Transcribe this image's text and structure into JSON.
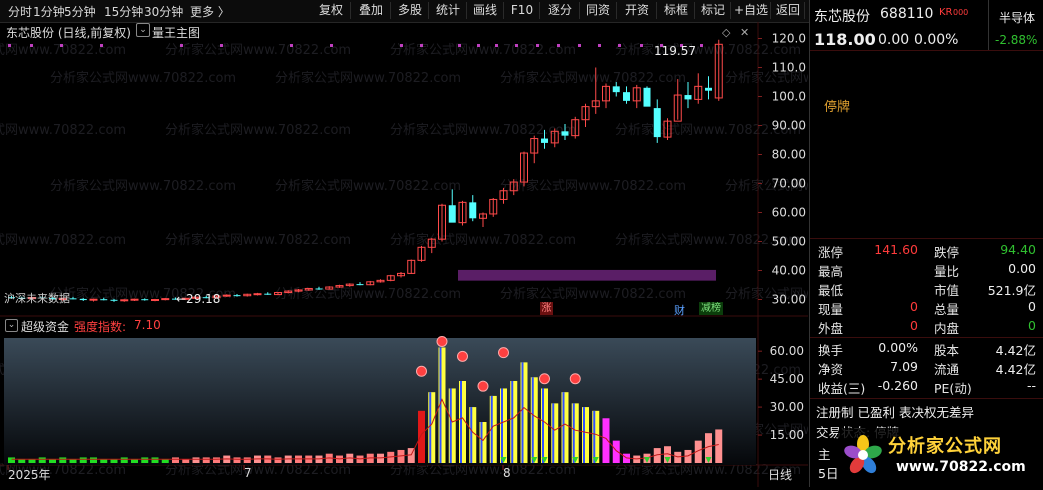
{
  "toolbar": {
    "periods": [
      "分时",
      "1分钟",
      "5分钟",
      "15分钟",
      "30分钟",
      "更多 〉"
    ],
    "buttons": [
      "复权",
      "叠加",
      "多股",
      "统计",
      "画线",
      "F10",
      "逐分",
      "同资",
      "开资",
      "标框",
      "标记",
      "+自选",
      "返回"
    ]
  },
  "main_chart": {
    "title": "东芯股份 (日线,前复权)",
    "indicator": "量王主图",
    "high_label": "119.57",
    "low_label": "←29.18",
    "stock_tag": "沪深未来数据",
    "y_ticks": [
      "120.0",
      "110.0",
      "100.0",
      "90.00",
      "80.00",
      "70.00",
      "60.00",
      "50.00",
      "40.00",
      "30.00"
    ],
    "markers": [
      "涨",
      "财",
      "减榜"
    ]
  },
  "sub_chart": {
    "title": "超级资金",
    "strength_label": "强度指数:",
    "strength_value": "7.10",
    "y_ticks": [
      "60.00",
      "45.00",
      "30.00",
      "15.00"
    ]
  },
  "x_axis": {
    "labels": [
      "2025年",
      "7",
      "8"
    ],
    "period": "日线"
  },
  "chart_data": {
    "type": "candlestick",
    "series_name": "东芯股份 日线 前复权",
    "ylim": [
      25,
      125
    ],
    "ohlc": [
      [
        30.8,
        31.2,
        30.2,
        30.6
      ],
      [
        30.6,
        31.0,
        30.0,
        30.3
      ],
      [
        30.3,
        30.9,
        29.9,
        30.7
      ],
      [
        30.7,
        31.1,
        30.3,
        30.5
      ],
      [
        30.5,
        30.8,
        29.8,
        30.0
      ],
      [
        30.0,
        30.6,
        29.6,
        30.4
      ],
      [
        30.4,
        30.9,
        30.1,
        30.2
      ],
      [
        30.2,
        30.5,
        29.5,
        29.8
      ],
      [
        29.8,
        30.3,
        29.3,
        30.1
      ],
      [
        30.1,
        30.6,
        29.7,
        29.9
      ],
      [
        29.9,
        30.2,
        29.18,
        29.6
      ],
      [
        29.6,
        30.1,
        29.2,
        29.9
      ],
      [
        29.9,
        30.3,
        29.5,
        30.1
      ],
      [
        30.1,
        30.4,
        29.6,
        29.8
      ],
      [
        29.8,
        30.2,
        29.4,
        30.0
      ],
      [
        30.0,
        30.5,
        29.7,
        30.3
      ],
      [
        30.3,
        30.7,
        29.9,
        30.1
      ],
      [
        30.1,
        30.6,
        29.8,
        30.4
      ],
      [
        30.4,
        31.0,
        30.1,
        30.8
      ],
      [
        30.8,
        31.3,
        30.4,
        30.6
      ],
      [
        30.6,
        31.4,
        30.3,
        31.2
      ],
      [
        31.2,
        31.8,
        30.9,
        31.5
      ],
      [
        31.5,
        31.9,
        31.0,
        31.3
      ],
      [
        31.3,
        32.0,
        31.0,
        31.8
      ],
      [
        31.8,
        32.3,
        31.4,
        32.0
      ],
      [
        32.0,
        32.5,
        31.6,
        31.7
      ],
      [
        31.7,
        32.6,
        31.5,
        32.4
      ],
      [
        32.4,
        33.2,
        32.1,
        32.9
      ],
      [
        32.9,
        33.6,
        32.5,
        33.3
      ],
      [
        33.3,
        34.0,
        33.0,
        33.8
      ],
      [
        33.8,
        34.4,
        33.3,
        33.6
      ],
      [
        33.6,
        34.6,
        33.4,
        34.3
      ],
      [
        34.3,
        35.1,
        34.0,
        34.8
      ],
      [
        34.8,
        35.6,
        34.4,
        35.3
      ],
      [
        35.3,
        36.0,
        34.9,
        35.1
      ],
      [
        35.1,
        36.4,
        34.9,
        36.1
      ],
      [
        36.1,
        37.0,
        35.8,
        36.6
      ],
      [
        36.6,
        38.5,
        36.3,
        38.2
      ],
      [
        38.2,
        39.5,
        37.6,
        39.0
      ],
      [
        39.0,
        43.8,
        38.8,
        43.5
      ],
      [
        43.5,
        48.5,
        43.0,
        48.0
      ],
      [
        48.0,
        51.2,
        46.0,
        50.8
      ],
      [
        50.8,
        63.0,
        50.0,
        62.5
      ],
      [
        62.5,
        68.0,
        57.0,
        56.5
      ],
      [
        56.5,
        64.0,
        55.5,
        63.5
      ],
      [
        63.5,
        66.0,
        57.0,
        58.0
      ],
      [
        58.0,
        60.0,
        55.0,
        59.5
      ],
      [
        59.5,
        65.0,
        58.5,
        64.5
      ],
      [
        64.5,
        68.5,
        63.0,
        67.5
      ],
      [
        67.5,
        71.5,
        66.0,
        70.5
      ],
      [
        70.5,
        81.0,
        69.0,
        80.5
      ],
      [
        80.5,
        86.5,
        77.0,
        85.5
      ],
      [
        85.5,
        88.5,
        82.0,
        84.0
      ],
      [
        84.0,
        89.0,
        82.5,
        88.0
      ],
      [
        88.0,
        90.5,
        85.0,
        86.5
      ],
      [
        86.5,
        93.0,
        85.5,
        92.0
      ],
      [
        92.0,
        97.5,
        89.5,
        96.5
      ],
      [
        96.5,
        110.0,
        94.0,
        98.5
      ],
      [
        98.5,
        104.5,
        96.0,
        103.5
      ],
      [
        103.5,
        105.0,
        100.0,
        101.5
      ],
      [
        101.5,
        103.5,
        97.5,
        98.5
      ],
      [
        98.5,
        104.0,
        96.0,
        103.0
      ],
      [
        103.0,
        103.5,
        98.0,
        96.5
      ],
      [
        96.0,
        99.0,
        84.0,
        86.0
      ],
      [
        86.0,
        92.5,
        85.0,
        91.5
      ],
      [
        91.5,
        106.0,
        92.0,
        100.5
      ],
      [
        100.5,
        105.0,
        96.0,
        99.0
      ],
      [
        99.0,
        108.0,
        97.5,
        103.5
      ],
      [
        103.0,
        107.0,
        99.0,
        102.0
      ],
      [
        99.5,
        119.57,
        98.5,
        118.0
      ]
    ],
    "volume": [
      3,
      2,
      2,
      3,
      2,
      3,
      2,
      3,
      3,
      2,
      2,
      3,
      2,
      3,
      3,
      2,
      3,
      2,
      3,
      3,
      3,
      4,
      3,
      3,
      4,
      4,
      3,
      4,
      4,
      4,
      4,
      5,
      4,
      5,
      4,
      5,
      5,
      6,
      7,
      8,
      28,
      38,
      62,
      40,
      44,
      30,
      22,
      36,
      40,
      44,
      54,
      46,
      40,
      32,
      38,
      32,
      30,
      28,
      24,
      12,
      5,
      4,
      5,
      8,
      9,
      6,
      7,
      12,
      16,
      18
    ]
  },
  "right_panel": {
    "name": "东芯股份",
    "code": "688110",
    "tag": "KR",
    "tag2": "000",
    "sector": "半导体",
    "sector_change": "-2.88%",
    "price": "118.00",
    "change": "0.00",
    "change_pct": "0.00%",
    "status": "停牌",
    "quote": [
      {
        "l": "涨停",
        "v": "141.60",
        "vc": "#ff3b3b",
        "l2": "跌停",
        "v2": "94.40",
        "v2c": "#30c030"
      },
      {
        "l": "最高",
        "v": "",
        "vc": "#eee",
        "l2": "量比",
        "v2": "0.00",
        "v2c": "#eee"
      },
      {
        "l": "最低",
        "v": "",
        "vc": "#eee",
        "l2": "市值",
        "v2": "521.9亿",
        "v2c": "#eee"
      },
      {
        "l": "现量",
        "v": "0",
        "vc": "#ff3b3b",
        "l2": "总量",
        "v2": "0",
        "v2c": "#eee"
      },
      {
        "l": "外盘",
        "v": "0",
        "vc": "#ff3b3b",
        "l2": "内盘",
        "v2": "0",
        "v2c": "#30c030"
      }
    ],
    "finance": [
      {
        "l": "换手",
        "v": "0.00%",
        "l2": "股本",
        "v2": "4.42亿"
      },
      {
        "l": "净资",
        "v": "7.09",
        "l2": "流通",
        "v2": "4.42亿"
      },
      {
        "l": "收益(三)",
        "v": "-0.260",
        "l2": "PE(动)",
        "v2": "--"
      }
    ],
    "note1": "注册制 已盈利 表决权无差异",
    "note2": "交易状态: 停牌",
    "partial1": "主",
    "partial2": "5日"
  },
  "watermark": {
    "repeat_text": "分析家公式网www.70822.com",
    "logo_title": "分析家公式网",
    "logo_url": "www.70822.com"
  }
}
